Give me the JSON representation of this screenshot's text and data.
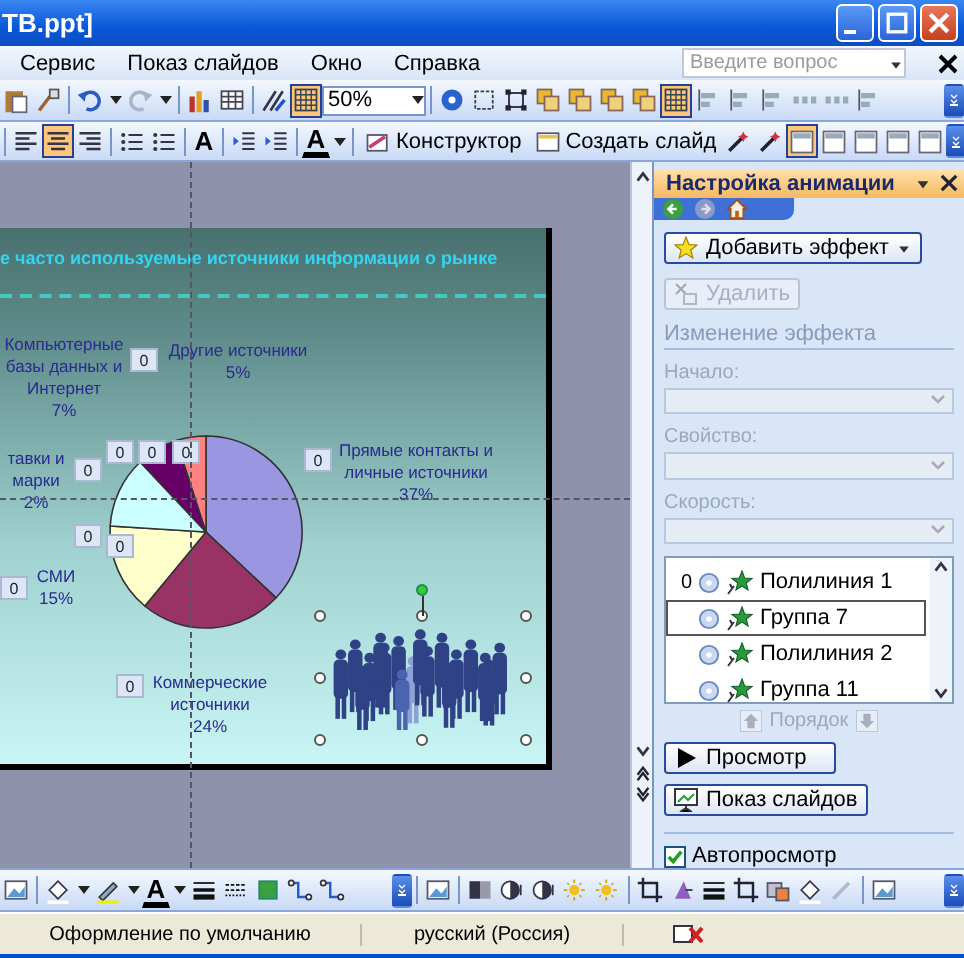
{
  "window": {
    "title": "ТВ.ppt]"
  },
  "menu": {
    "items": [
      "Сервис",
      "Показ слайдов",
      "Окно",
      "Справка"
    ],
    "help_box": {
      "placeholder": "Введите вопрос"
    }
  },
  "standard_toolbar": {
    "items": [
      {
        "kind": "icon",
        "pressed": false
      },
      {
        "kind": "icon",
        "pressed": false
      },
      {
        "kind": "separator"
      },
      {
        "kind": "icon",
        "pressed": false
      },
      {
        "kind": "icon",
        "pressed": false
      },
      {
        "kind": "icon",
        "pressed": false
      },
      {
        "kind": "icon",
        "pressed": false
      },
      {
        "kind": "separator"
      },
      {
        "kind": "icon",
        "pressed": false
      },
      {
        "kind": "icon",
        "pressed": false
      },
      {
        "kind": "separator"
      },
      {
        "kind": "icon",
        "pressed": false
      },
      {
        "kind": "icon",
        "pressed": true
      },
      {
        "kind": "combo",
        "value": "50%"
      },
      {
        "kind": "separator"
      },
      {
        "kind": "icon",
        "pressed": false
      },
      {
        "kind": "icon",
        "pressed": false
      },
      {
        "kind": "icon",
        "pressed": false
      },
      {
        "kind": "icon",
        "pressed": false
      },
      {
        "kind": "icon",
        "pressed": false
      },
      {
        "kind": "icon",
        "pressed": false
      },
      {
        "kind": "icon",
        "pressed": false
      },
      {
        "kind": "icon",
        "pressed": true
      },
      {
        "kind": "icon",
        "pressed": false
      },
      {
        "kind": "icon",
        "pressed": false
      },
      {
        "kind": "icon",
        "pressed": false
      },
      {
        "kind": "icon",
        "pressed": false
      },
      {
        "kind": "icon",
        "pressed": false
      },
      {
        "kind": "icon",
        "pressed": false
      },
      {
        "kind": "icon",
        "pressed": false
      }
    ]
  },
  "formatting_toolbar": {
    "items": [
      {
        "kind": "separator"
      },
      {
        "kind": "icon",
        "pressed": false
      },
      {
        "kind": "icon",
        "pressed": true
      },
      {
        "kind": "icon",
        "pressed": false
      },
      {
        "kind": "separator"
      },
      {
        "kind": "icon",
        "pressed": false
      },
      {
        "kind": "icon",
        "pressed": false
      },
      {
        "kind": "separator"
      },
      {
        "kind": "glyph",
        "text": "A",
        "pressed": false
      },
      {
        "kind": "separator"
      },
      {
        "kind": "icon",
        "pressed": false
      },
      {
        "kind": "icon",
        "pressed": false
      },
      {
        "kind": "separator"
      },
      {
        "kind": "glyph",
        "text": "A",
        "pressed": false
      },
      {
        "kind": "icon",
        "pressed": false
      },
      {
        "kind": "separator"
      },
      {
        "kind": "button",
        "label": "Конструктор"
      },
      {
        "kind": "button",
        "label": "Создать слайд"
      },
      {
        "kind": "icon",
        "pressed": false
      },
      {
        "kind": "icon",
        "pressed": false
      },
      {
        "kind": "icon",
        "pressed": true
      },
      {
        "kind": "icon",
        "pressed": false
      },
      {
        "kind": "icon",
        "pressed": false
      },
      {
        "kind": "icon",
        "pressed": false
      },
      {
        "kind": "icon",
        "pressed": false
      },
      {
        "kind": "icon",
        "pressed": false
      }
    ]
  },
  "slide": {
    "title": "е часто используемые источники информации о рынке",
    "chart_data": {
      "type": "pie",
      "values": [
        37,
        24,
        15,
        12,
        7,
        5
      ],
      "colors": [
        "#9a96e2",
        "#993366",
        "#ffffcc",
        "#ccffff",
        "#660066",
        "#ff8080"
      ]
    },
    "labels": [
      {
        "text": "Компьютерные базы данных и Интернет",
        "value": "7%"
      },
      {
        "text": "Другие источники",
        "value": "5%"
      },
      {
        "text": "тавки и марки",
        "value": "2%"
      },
      {
        "text": "Прямые контакты и личные источники",
        "value": "37%"
      },
      {
        "text": "СМИ",
        "value": "15%"
      },
      {
        "text": "Коммерческие источники",
        "value": "24%"
      }
    ],
    "animation_tags": [
      "0",
      "0",
      "0",
      "0",
      "0",
      "0",
      "0",
      "0",
      "0",
      "0"
    ]
  },
  "task_pane": {
    "title": "Настройка анимации",
    "add_effect": "Добавить эффект",
    "remove": "Удалить",
    "section": "Изменение эффекта",
    "fields": [
      {
        "label": "Начало:"
      },
      {
        "label": "Свойство:"
      },
      {
        "label": "Скорость:"
      }
    ],
    "effects": [
      {
        "order": "0",
        "name": "Полилиния 1",
        "selected": false
      },
      {
        "name": "Группа 7",
        "selected": true
      },
      {
        "name": "Полилиния 2",
        "selected": false
      },
      {
        "name": "Группа 11",
        "selected": false
      }
    ],
    "reorder_label": "Порядок",
    "play_button": "Просмотр",
    "slideshow_button": "Показ слайдов",
    "autopreview": {
      "label": "Автопросмотр",
      "checked": true
    }
  },
  "drawing_toolbar": {
    "items": [
      {
        "kind": "icon",
        "pressed": false
      },
      {
        "kind": "separator"
      },
      {
        "kind": "icon",
        "pressed": false
      },
      {
        "kind": "icon",
        "pressed": false
      },
      {
        "kind": "icon",
        "pressed": false
      },
      {
        "kind": "icon",
        "pressed": false
      },
      {
        "kind": "glyph",
        "text": "A",
        "pressed": false
      },
      {
        "kind": "icon",
        "pressed": false
      },
      {
        "kind": "icon",
        "pressed": false
      },
      {
        "kind": "icon",
        "pressed": false
      },
      {
        "kind": "icon",
        "pressed": false
      },
      {
        "kind": "icon",
        "pressed": false
      },
      {
        "kind": "icon",
        "pressed": false
      },
      {
        "kind": "icon",
        "pressed": false
      },
      {
        "kind": "separator"
      },
      {
        "kind": "icon",
        "pressed": false
      },
      {
        "kind": "separator"
      },
      {
        "kind": "icon",
        "pressed": false
      },
      {
        "kind": "icon",
        "pressed": false
      },
      {
        "kind": "icon",
        "pressed": false
      },
      {
        "kind": "icon",
        "pressed": false
      },
      {
        "kind": "icon",
        "pressed": false
      },
      {
        "kind": "separator"
      },
      {
        "kind": "icon",
        "pressed": false
      },
      {
        "kind": "icon",
        "pressed": false
      },
      {
        "kind": "icon",
        "pressed": false
      },
      {
        "kind": "icon",
        "pressed": false
      },
      {
        "kind": "icon",
        "pressed": false
      },
      {
        "kind": "icon",
        "pressed": false
      },
      {
        "kind": "icon",
        "pressed": false
      },
      {
        "kind": "separator"
      },
      {
        "kind": "icon",
        "pressed": false
      },
      {
        "kind": "icon",
        "pressed": false
      }
    ]
  },
  "status_bar": [
    "Оформление по умолчанию",
    "русский (Россия)"
  ]
}
